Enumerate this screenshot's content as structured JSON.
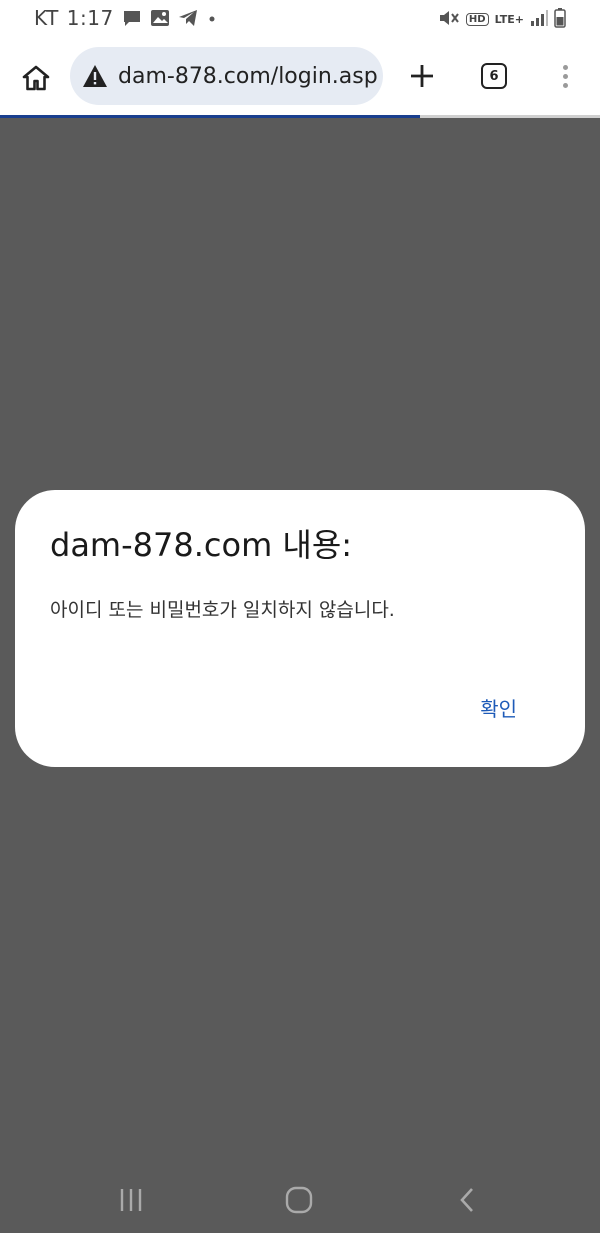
{
  "status_bar": {
    "carrier": "KT",
    "time": "1:17",
    "network": "LTE+",
    "hd_label": "HD",
    "icons": [
      "chat-icon",
      "image-icon",
      "telegram-icon",
      "dot-icon",
      "mute-icon",
      "hd-voice-icon",
      "lte-icon",
      "signal-icon",
      "battery-icon"
    ]
  },
  "browser": {
    "url": "dam-878.com/login.asp",
    "tab_count": "6",
    "load_progress": 0.7,
    "icons": [
      "home-icon",
      "warning-icon",
      "plus-icon",
      "tabs-icon",
      "more-vert-icon"
    ]
  },
  "dialog": {
    "title": "dam-878.com 내용:",
    "message": "아이디 또는 비밀번호가 일치하지 않습니다.",
    "ok_label": "확인",
    "ok_color": "#1e5bb8"
  },
  "nav_bar": {
    "icons": [
      "recent-apps-icon",
      "home-nav-icon",
      "back-icon"
    ]
  },
  "colors": {
    "overlay": "#5a5a5a",
    "url_bar_bg": "#e6ebf3",
    "progress": "#1a3f8f"
  }
}
